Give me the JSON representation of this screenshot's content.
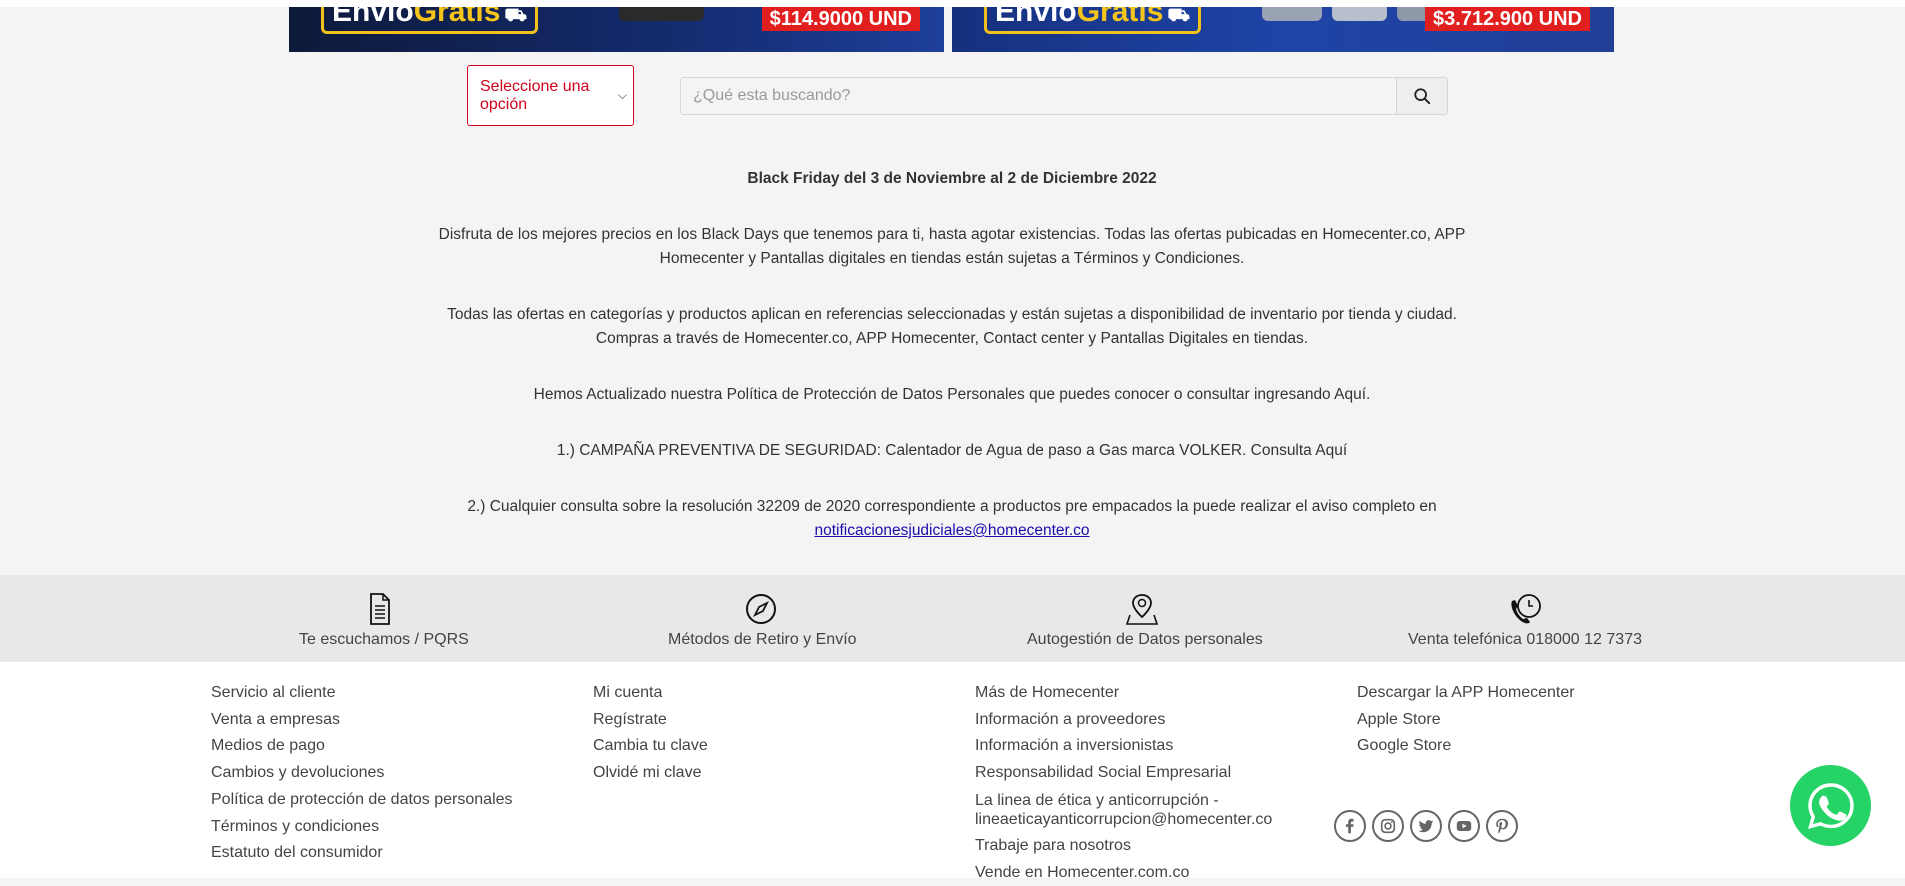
{
  "banners": [
    {
      "envio_1": "Envío",
      "envio_2": "Gratis",
      "price": "$114.9000 UND"
    },
    {
      "envio_1": "Envío",
      "envio_2": "Gratis",
      "price": "$3.712.900 UND"
    }
  ],
  "search": {
    "select_value": "Seleccione una opción",
    "placeholder": "¿Qué esta buscando?"
  },
  "info": {
    "heading": "Black Friday del 3 de Noviembre al 2 de Diciembre 2022",
    "p1_line1": "Disfruta de los mejores precios en los Black Days que tenemos para ti, hasta agotar existencias. Todas las ofertas pubicadas en Homecenter.co, APP",
    "p1_line2": "Homecenter y Pantallas digitales en tiendas están sujetas a Términos y Condiciones.",
    "p2_line1": "Todas las ofertas en categorías y productos aplican en referencias seleccionadas y están sujetas a disponibilidad de inventario por tienda y ciudad.",
    "p2_line2": "Compras a través de Homecenter.co, APP Homecenter, Contact center y Pantallas Digitales en tiendas.",
    "p3": "Hemos Actualizado nuestra Política de Protección de Datos Personales que puedes conocer o consultar ingresando Aquí.",
    "p4": "1.) CAMPAÑA PREVENTIVA DE SEGURIDAD: Calentador de Agua de paso a Gas marca VOLKER. Consulta Aquí",
    "p5_line1": "2.) Cualquier consulta sobre la resolución 32209 de 2020 correspondiente a productos pre empacados la puede realizar el aviso completo en",
    "p5_link": "notificacionesjudiciales@homecenter.co"
  },
  "services": [
    {
      "label": "Te escuchamos / PQRS",
      "icon": "document-icon"
    },
    {
      "label": "Métodos de Retiro y Envío",
      "icon": "compass-icon"
    },
    {
      "label": "Autogestión de Datos personales",
      "icon": "map-pin-icon"
    },
    {
      "label": "Venta telefónica 018000 12 7373",
      "icon": "phone-clock-icon"
    }
  ],
  "footer": {
    "col1": [
      "Servicio al cliente",
      "Venta a empresas",
      "Medios de pago",
      "Cambios y devoluciones",
      "Política de protección de datos personales",
      "Términos y condiciones",
      "Estatuto del consumidor"
    ],
    "col2": [
      "Mi cuenta",
      "Regístrate",
      "Cambia tu clave",
      "Olvidé mi clave"
    ],
    "col3": [
      "Más de Homecenter",
      "Información a proveedores",
      "Información a inversionistas",
      "Responsabilidad Social Empresarial"
    ],
    "col3_two_line_a": "La linea de ética y anticorrupción -",
    "col3_two_line_b": "lineaeticayanticorrupcion@homecenter.co",
    "col3_rest": [
      "Trabaje para nosotros",
      "Vende en Homecenter.com.co"
    ],
    "col4": [
      "Descargar la APP Homecenter",
      "Apple Store",
      "Google Store"
    ]
  },
  "social": [
    "facebook-icon",
    "instagram-icon",
    "twitter-icon",
    "youtube-icon",
    "pinterest-icon"
  ],
  "colors": {
    "accent": "#d0021b",
    "whatsapp": "#25d366",
    "link": "#1a0dab"
  }
}
